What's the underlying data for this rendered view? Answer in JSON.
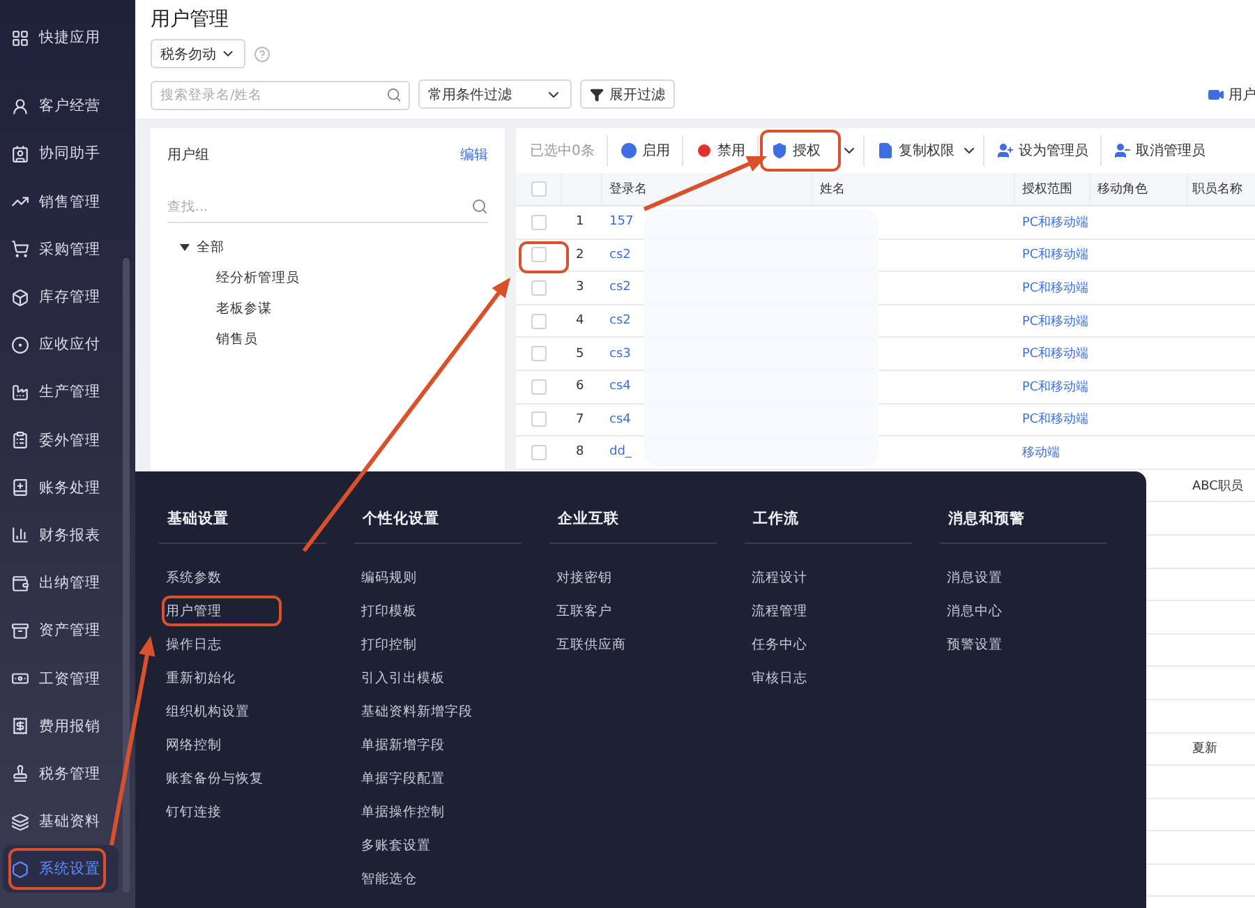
{
  "sidebar": {
    "items": [
      {
        "label": "快捷应用",
        "selected": false,
        "annotated": false
      },
      {
        "label": "客户经营",
        "selected": false,
        "annotated": false
      },
      {
        "label": "协同助手",
        "selected": false,
        "annotated": false
      },
      {
        "label": "销售管理",
        "selected": false,
        "annotated": false
      },
      {
        "label": "采购管理",
        "selected": false,
        "annotated": false
      },
      {
        "label": "库存管理",
        "selected": false,
        "annotated": false
      },
      {
        "label": "应收应付",
        "selected": false,
        "annotated": false
      },
      {
        "label": "生产管理",
        "selected": false,
        "annotated": false
      },
      {
        "label": "委外管理",
        "selected": false,
        "annotated": false
      },
      {
        "label": "账务处理",
        "selected": false,
        "annotated": false
      },
      {
        "label": "财务报表",
        "selected": false,
        "annotated": false
      },
      {
        "label": "出纳管理",
        "selected": false,
        "annotated": false
      },
      {
        "label": "资产管理",
        "selected": false,
        "annotated": false
      },
      {
        "label": "工资管理",
        "selected": false,
        "annotated": false
      },
      {
        "label": "费用报销",
        "selected": false,
        "annotated": false
      },
      {
        "label": "税务管理",
        "selected": false,
        "annotated": false
      },
      {
        "label": "基础资料",
        "selected": false,
        "annotated": false
      },
      {
        "label": "系统设置",
        "selected": true,
        "annotated": true
      }
    ]
  },
  "header": {
    "title": "用户管理",
    "account_dropdown": "税务勿动",
    "search": {
      "placeholder": "搜索登录名/姓名"
    },
    "filter_dropdown": "常用条件过滤",
    "expand_filter_button": "展开过滤",
    "help_link": "用户"
  },
  "user_groups": {
    "title": "用户组",
    "edit_link": "编辑",
    "search": {
      "placeholder": "查找..."
    },
    "tree": [
      {
        "label": "全部",
        "expanded": true,
        "children": [
          {
            "label": "经分析管理员"
          },
          {
            "label": "老板参谋"
          },
          {
            "label": "销售员"
          }
        ]
      }
    ]
  },
  "toolbar": {
    "selected_count": "已选中0条",
    "buttons": [
      {
        "label": "启用",
        "kind": "enable",
        "dropdown": false,
        "annotated": false
      },
      {
        "label": "禁用",
        "kind": "disable",
        "dropdown": false,
        "annotated": false
      },
      {
        "label": "授权",
        "kind": "authorize",
        "dropdown": true,
        "annotated": true
      },
      {
        "label": "复制权限",
        "kind": "copy",
        "dropdown": true,
        "annotated": false
      },
      {
        "label": "设为管理员",
        "kind": "set-admin",
        "dropdown": false,
        "annotated": false
      },
      {
        "label": "取消管理员",
        "kind": "unset-admin",
        "dropdown": false,
        "annotated": false
      }
    ]
  },
  "table": {
    "all_checked": false,
    "columns": [
      "登录名",
      "姓名",
      "授权范围",
      "移动角色",
      "职员名称"
    ],
    "rows": [
      {
        "index": "1",
        "login": "157",
        "checked": false,
        "annotated": false,
        "scope": "PC和移动端"
      },
      {
        "index": "2",
        "login": "cs2",
        "checked": false,
        "annotated": true,
        "scope": "PC和移动端"
      },
      {
        "index": "3",
        "login": "cs2",
        "checked": false,
        "annotated": false,
        "scope": "PC和移动端"
      },
      {
        "index": "4",
        "login": "cs2",
        "checked": false,
        "annotated": false,
        "scope": "PC和移动端"
      },
      {
        "index": "5",
        "login": "cs3",
        "checked": false,
        "annotated": false,
        "scope": "PC和移动端"
      },
      {
        "index": "6",
        "login": "cs4",
        "checked": false,
        "annotated": false,
        "scope": "PC和移动端"
      },
      {
        "index": "7",
        "login": "cs4",
        "checked": false,
        "annotated": false,
        "scope": "PC和移动端"
      },
      {
        "index": "8",
        "login": "dd_",
        "checked": false,
        "annotated": false,
        "scope": "移动端"
      }
    ],
    "covered_rows": [
      {
        "staff_name": "ABC职员"
      },
      {},
      {},
      {},
      {},
      {},
      {},
      {},
      {
        "staff_name": "夏新"
      },
      {},
      {},
      {},
      {}
    ]
  },
  "menu": {
    "columns": [
      {
        "title": "基础设置",
        "items": [
          {
            "label": "系统参数",
            "annotated": false
          },
          {
            "label": "用户管理",
            "annotated": true
          },
          {
            "label": "操作日志",
            "annotated": false
          },
          {
            "label": "重新初始化",
            "annotated": false
          },
          {
            "label": "组织机构设置",
            "annotated": false
          },
          {
            "label": "网络控制",
            "annotated": false
          },
          {
            "label": "账套备份与恢复",
            "annotated": false
          },
          {
            "label": "钉钉连接",
            "annotated": false
          }
        ]
      },
      {
        "title": "个性化设置",
        "items": [
          {
            "label": "编码规则",
            "annotated": false
          },
          {
            "label": "打印模板",
            "annotated": false
          },
          {
            "label": "打印控制",
            "annotated": false
          },
          {
            "label": "引入引出模板",
            "annotated": false
          },
          {
            "label": "基础资料新增字段",
            "annotated": false
          },
          {
            "label": "单据新增字段",
            "annotated": false
          },
          {
            "label": "单据字段配置",
            "annotated": false
          },
          {
            "label": "单据操作控制",
            "annotated": false
          },
          {
            "label": "多账套设置",
            "annotated": false
          },
          {
            "label": "智能选仓",
            "annotated": false
          }
        ]
      },
      {
        "title": "企业互联",
        "items": [
          {
            "label": "对接密钥",
            "annotated": false
          },
          {
            "label": "互联客户",
            "annotated": false
          },
          {
            "label": "互联供应商",
            "annotated": false
          }
        ]
      },
      {
        "title": "工作流",
        "items": [
          {
            "label": "流程设计",
            "annotated": false
          },
          {
            "label": "流程管理",
            "annotated": false
          },
          {
            "label": "任务中心",
            "annotated": false
          },
          {
            "label": "审核日志",
            "annotated": false
          }
        ]
      },
      {
        "title": "消息和预警",
        "items": [
          {
            "label": "消息设置",
            "annotated": false
          },
          {
            "label": "消息中心",
            "annotated": false
          },
          {
            "label": "预警设置",
            "annotated": false
          }
        ]
      }
    ]
  }
}
